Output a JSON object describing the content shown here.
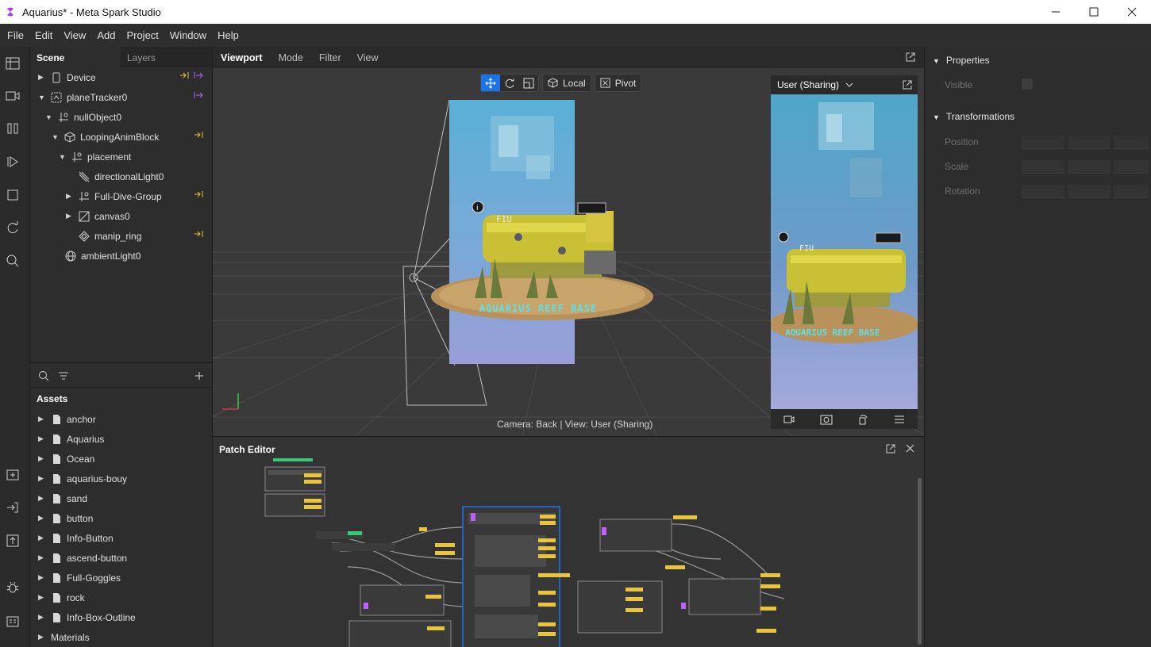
{
  "window": {
    "title": "Aquarius* - Meta Spark Studio"
  },
  "menu": [
    "File",
    "Edit",
    "View",
    "Add",
    "Project",
    "Window",
    "Help"
  ],
  "scene_panel": {
    "tabs": [
      "Scene",
      "Layers"
    ],
    "tree": [
      {
        "label": "Device",
        "icon": "device-icon"
      },
      {
        "label": "planeTracker0",
        "icon": "plane-tracker-icon"
      },
      {
        "label": "nullObject0",
        "icon": "null-object-icon"
      },
      {
        "label": "LoopingAnimBlock",
        "icon": "block-icon"
      },
      {
        "label": "placement",
        "icon": "null-object-icon"
      },
      {
        "label": "directionalLight0",
        "icon": "directional-light-icon"
      },
      {
        "label": "Full-Dive-Group",
        "icon": "null-object-icon"
      },
      {
        "label": "canvas0",
        "icon": "canvas-icon"
      },
      {
        "label": "manip_ring",
        "icon": "mesh-icon"
      },
      {
        "label": "ambientLight0",
        "icon": "ambient-light-icon"
      }
    ]
  },
  "assets": {
    "title": "Assets",
    "items": [
      "anchor",
      "Aquarius",
      "Ocean",
      "aquarius-bouy",
      "sand",
      "button",
      "Info-Button",
      "ascend-button",
      "Full-Goggles",
      "rock",
      "Info-Box-Outline",
      "Materials"
    ]
  },
  "viewport": {
    "tabs": [
      "Viewport",
      "Mode",
      "Filter",
      "View"
    ],
    "tools": {
      "local": "Local",
      "pivot": "Pivot"
    },
    "camera_status": "Camera: Back | View: User (Sharing)",
    "scene_text": "AQUARIUS REEF BASE",
    "sign_text": "FIU"
  },
  "preview": {
    "dropdown": "User (Sharing)"
  },
  "patch_editor": {
    "title": "Patch Editor"
  },
  "properties": {
    "sections": [
      "Properties",
      "Transformations"
    ],
    "visible_label": "Visible",
    "fields": [
      "Position",
      "Scale",
      "Rotation"
    ]
  },
  "colors": {
    "accent": "#1a73e8",
    "link_yellow": "#e8c53a",
    "link_magenta": "#c060ff"
  }
}
